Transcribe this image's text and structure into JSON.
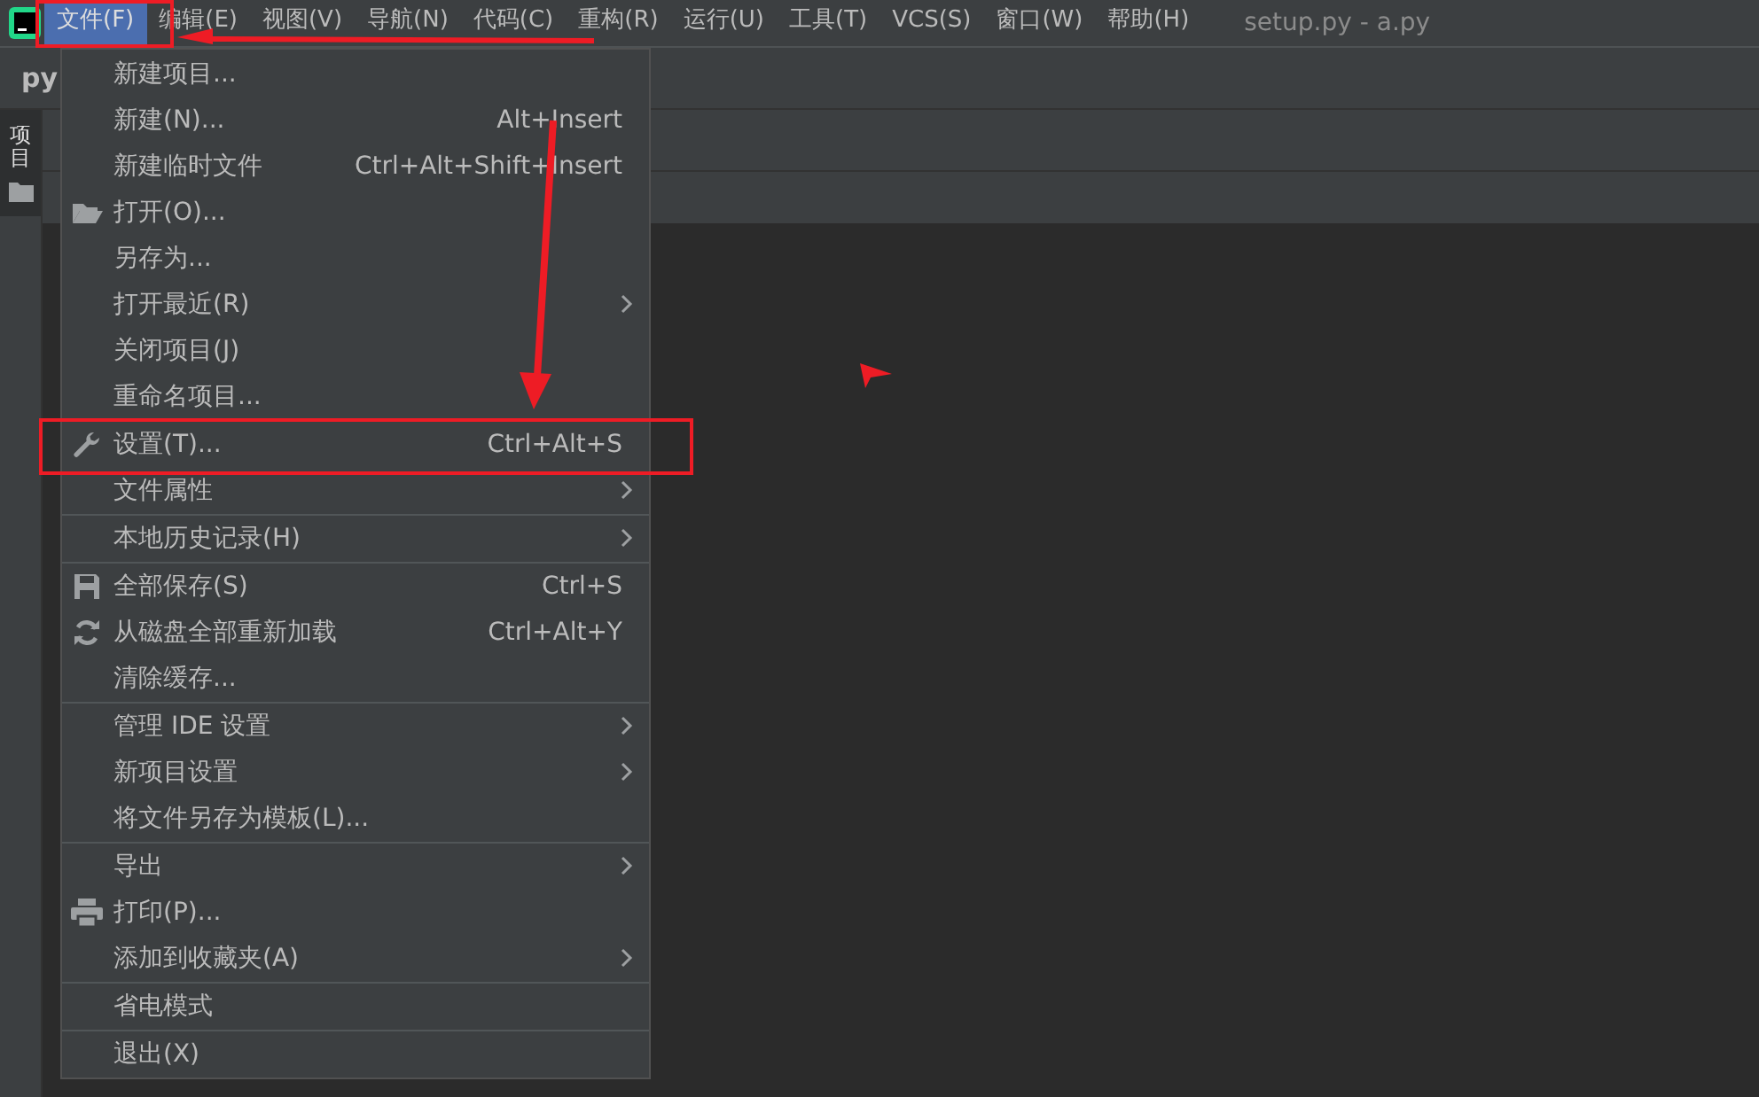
{
  "menubar": {
    "items": [
      {
        "label": "文件(F)",
        "selected": true
      },
      {
        "label": "编辑(E)",
        "selected": false
      },
      {
        "label": "视图(V)",
        "selected": false
      },
      {
        "label": "导航(N)",
        "selected": false
      },
      {
        "label": "代码(C)",
        "selected": false
      },
      {
        "label": "重构(R)",
        "selected": false
      },
      {
        "label": "运行(U)",
        "selected": false
      },
      {
        "label": "工具(T)",
        "selected": false
      },
      {
        "label": "VCS(S)",
        "selected": false
      },
      {
        "label": "窗口(W)",
        "selected": false
      },
      {
        "label": "帮助(H)",
        "selected": false
      }
    ],
    "title": "setup.py - a.py"
  },
  "project_bar": {
    "title": "py"
  },
  "tool_strip": {
    "label": "项目"
  },
  "file_menu": {
    "groups": [
      [
        {
          "label": "新建项目...",
          "submenu": false
        },
        {
          "label": "新建(N)...",
          "shortcut": "Alt+Insert",
          "submenu": false
        },
        {
          "label": "新建临时文件",
          "shortcut": "Ctrl+Alt+Shift+Insert",
          "submenu": false
        },
        {
          "label": "打开(O)...",
          "kind": "folder",
          "submenu": false
        },
        {
          "label": "另存为...",
          "submenu": false
        },
        {
          "label": "打开最近(R)",
          "submenu": true
        },
        {
          "label": "关闭项目(J)",
          "submenu": false
        },
        {
          "label": "重命名项目...",
          "submenu": false
        }
      ],
      [
        {
          "label": "设置(T)...",
          "shortcut": "Ctrl+Alt+S",
          "kind": "wrench",
          "submenu": false
        },
        {
          "label": "文件属性",
          "submenu": true
        }
      ],
      [
        {
          "label": "本地历史记录(H)",
          "submenu": true
        }
      ],
      [
        {
          "label": "全部保存(S)",
          "shortcut": "Ctrl+S",
          "kind": "save",
          "submenu": false
        },
        {
          "label": "从磁盘全部重新加载",
          "shortcut": "Ctrl+Alt+Y",
          "kind": "reload",
          "submenu": false
        },
        {
          "label": "清除缓存...",
          "submenu": false
        }
      ],
      [
        {
          "label": "管理 IDE 设置",
          "submenu": true
        },
        {
          "label": "新项目设置",
          "submenu": true
        },
        {
          "label": "将文件另存为模板(L)...",
          "submenu": false
        }
      ],
      [
        {
          "label": "导出",
          "submenu": true
        },
        {
          "label": "打印(P)...",
          "kind": "printer",
          "submenu": false
        },
        {
          "label": "添加到收藏夹(A)",
          "submenu": true
        }
      ],
      [
        {
          "label": "省电模式",
          "submenu": false
        }
      ],
      [
        {
          "label": "退出(X)",
          "submenu": false
        }
      ]
    ]
  }
}
